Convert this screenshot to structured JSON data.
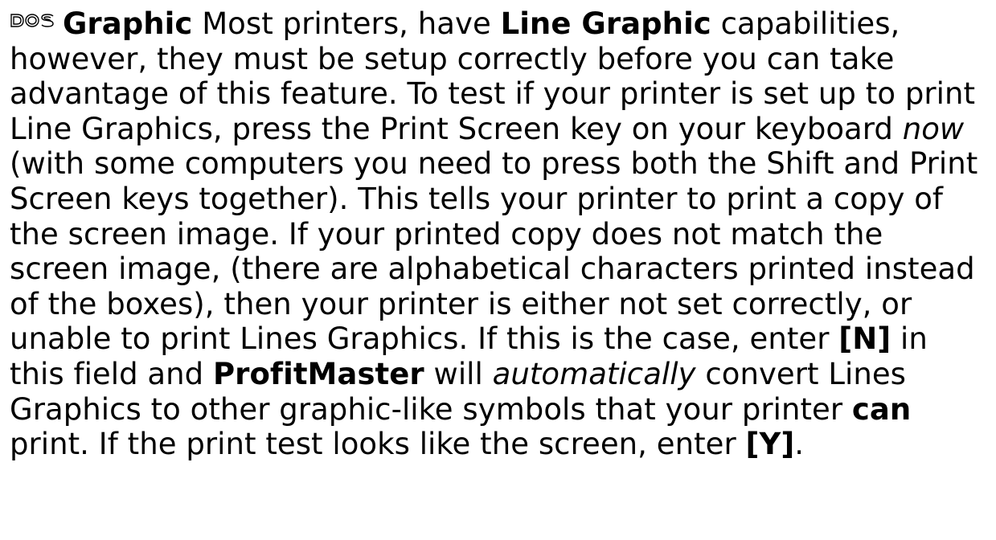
{
  "badge": {
    "icon": "dos-icon",
    "text": "DOS"
  },
  "paragraph": {
    "field_name": "Graphic",
    "t1": " Most printers, have ",
    "b_line_graphic": "Line Graphic",
    "t2": " capabilities, however, they must be setup correctly before you can take advantage of this feature. To test if your printer is set up to print Line Graphics, press the Print Screen key on your keyboard ",
    "i_now": "now",
    "t3": " (with some computers you need to press both the Shift and Print Screen keys together). This tells your printer to print a copy of the screen image. If your printed copy does not match the screen image, (there are alphabetical characters printed instead of the boxes), then your printer is either not set correctly, or unable to print Lines Graphics. If this is the case, enter ",
    "b_n": "[N]",
    "t4": " in this field and ",
    "b_profitmaster": "ProfitMaster",
    "t5": " will ",
    "i_automatically": "automatically",
    "t6": " convert Lines Graphics to other graphic-like symbols that your printer ",
    "b_can": "can",
    "t7": " print. If the print test looks like the screen, enter ",
    "b_y": "[Y]",
    "t8": "."
  }
}
